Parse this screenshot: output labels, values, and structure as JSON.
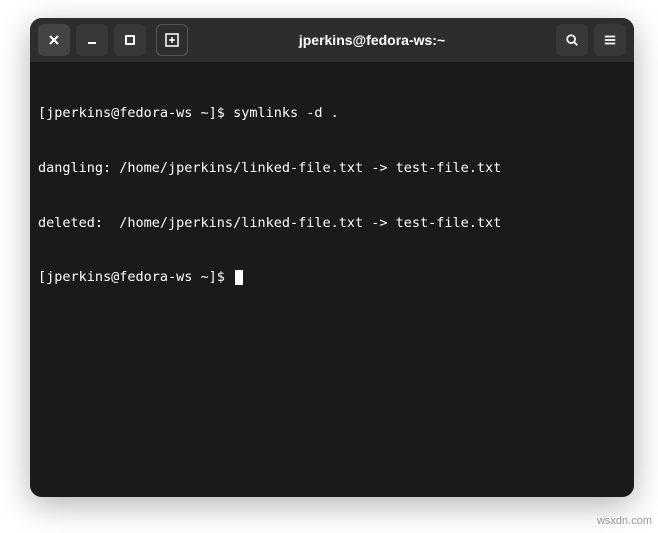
{
  "window": {
    "title": "jperkins@fedora-ws:~"
  },
  "terminal": {
    "lines": {
      "l0_prompt": "[jperkins@fedora-ws ~]$ ",
      "l0_cmd": "symlinks -d .",
      "l1": "dangling: /home/jperkins/linked-file.txt -> test-file.txt",
      "l2": "deleted:  /home/jperkins/linked-file.txt -> test-file.txt",
      "l3_prompt": "[jperkins@fedora-ws ~]$ "
    }
  },
  "watermark": "wsxdn.com"
}
